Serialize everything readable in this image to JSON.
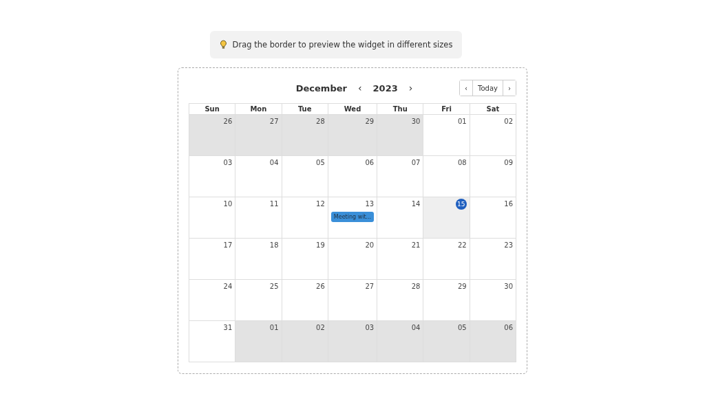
{
  "hint": {
    "text": "Drag the border to preview the widget in different sizes"
  },
  "header": {
    "month": "December",
    "prev_year": "‹",
    "year": "2023",
    "next_year": "›",
    "prev": "‹",
    "today": "Today",
    "next": "›"
  },
  "weekdays": [
    "Sun",
    "Mon",
    "Tue",
    "Wed",
    "Thu",
    "Fri",
    "Sat"
  ],
  "weeks": [
    [
      {
        "day": "26",
        "muted": true,
        "today": false
      },
      {
        "day": "27",
        "muted": true,
        "today": false
      },
      {
        "day": "28",
        "muted": true,
        "today": false
      },
      {
        "day": "29",
        "muted": true,
        "today": false
      },
      {
        "day": "30",
        "muted": true,
        "today": false
      },
      {
        "day": "01",
        "muted": false,
        "today": false
      },
      {
        "day": "02",
        "muted": false,
        "today": false
      }
    ],
    [
      {
        "day": "03",
        "muted": false,
        "today": false
      },
      {
        "day": "04",
        "muted": false,
        "today": false
      },
      {
        "day": "05",
        "muted": false,
        "today": false
      },
      {
        "day": "06",
        "muted": false,
        "today": false
      },
      {
        "day": "07",
        "muted": false,
        "today": false
      },
      {
        "day": "08",
        "muted": false,
        "today": false
      },
      {
        "day": "09",
        "muted": false,
        "today": false
      }
    ],
    [
      {
        "day": "10",
        "muted": false,
        "today": false
      },
      {
        "day": "11",
        "muted": false,
        "today": false
      },
      {
        "day": "12",
        "muted": false,
        "today": false
      },
      {
        "day": "13",
        "muted": false,
        "today": false,
        "events": [
          "Meeting wit..."
        ]
      },
      {
        "day": "14",
        "muted": false,
        "today": false
      },
      {
        "day": "15",
        "muted": false,
        "today": true
      },
      {
        "day": "16",
        "muted": false,
        "today": false
      }
    ],
    [
      {
        "day": "17",
        "muted": false,
        "today": false
      },
      {
        "day": "18",
        "muted": false,
        "today": false
      },
      {
        "day": "19",
        "muted": false,
        "today": false
      },
      {
        "day": "20",
        "muted": false,
        "today": false
      },
      {
        "day": "21",
        "muted": false,
        "today": false
      },
      {
        "day": "22",
        "muted": false,
        "today": false
      },
      {
        "day": "23",
        "muted": false,
        "today": false
      }
    ],
    [
      {
        "day": "24",
        "muted": false,
        "today": false
      },
      {
        "day": "25",
        "muted": false,
        "today": false
      },
      {
        "day": "26",
        "muted": false,
        "today": false
      },
      {
        "day": "27",
        "muted": false,
        "today": false
      },
      {
        "day": "28",
        "muted": false,
        "today": false
      },
      {
        "day": "29",
        "muted": false,
        "today": false
      },
      {
        "day": "30",
        "muted": false,
        "today": false
      }
    ],
    [
      {
        "day": "31",
        "muted": false,
        "today": false
      },
      {
        "day": "01",
        "muted": true,
        "today": false
      },
      {
        "day": "02",
        "muted": true,
        "today": false
      },
      {
        "day": "03",
        "muted": true,
        "today": false
      },
      {
        "day": "04",
        "muted": true,
        "today": false
      },
      {
        "day": "05",
        "muted": true,
        "today": false
      },
      {
        "day": "06",
        "muted": true,
        "today": false
      }
    ]
  ]
}
